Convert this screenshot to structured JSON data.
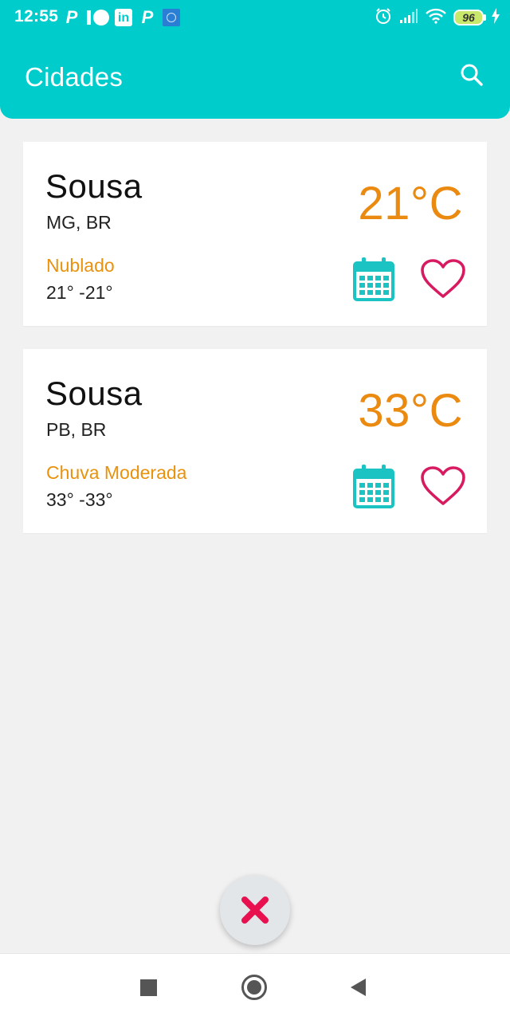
{
  "status_bar": {
    "time": "12:55",
    "notification_icons": [
      "p-icon",
      "patreon-icon",
      "linkedin-icon",
      "p-icon",
      "app-icon"
    ],
    "linkedin_label": "in",
    "battery_level": "96"
  },
  "app_bar": {
    "title": "Cidades",
    "search_icon": "search-icon"
  },
  "cities": [
    {
      "name": "Sousa",
      "region": "MG, BR",
      "temperature": "21°C",
      "condition": "Nublado",
      "range": "21° -21°"
    },
    {
      "name": "Sousa",
      "region": "PB, BR",
      "temperature": "33°C",
      "condition": "Chuva Moderada",
      "range": "33° -33°"
    }
  ],
  "fab": {
    "icon": "close-icon"
  },
  "nav_bar": {
    "icons": [
      "recents-icon",
      "home-icon",
      "back-icon"
    ]
  },
  "colors": {
    "primary": "#00cccc",
    "temperature": "#ea8a10",
    "condition": "#e8920e",
    "calendar": "#1cc3c3",
    "favorite": "#d81b60",
    "fab_icon": "#e8104f"
  }
}
